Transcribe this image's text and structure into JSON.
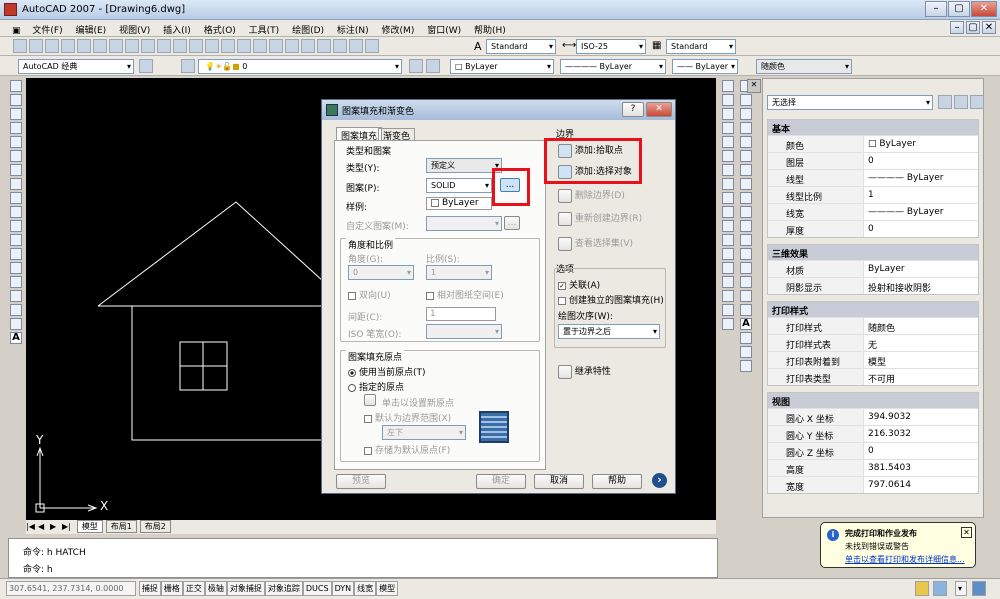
{
  "window": {
    "title": "AutoCAD 2007 - [Drawing6.dwg]"
  },
  "menu": [
    "文件(F)",
    "编辑(E)",
    "视图(V)",
    "插入(I)",
    "格式(O)",
    "工具(T)",
    "绘图(D)",
    "标注(N)",
    "修改(M)",
    "窗口(W)",
    "帮助(H)"
  ],
  "toolbar": {
    "text_style": "Standard",
    "dim_style": "ISO-25",
    "table_style": "Standard",
    "workspace": "AutoCAD 经典",
    "layer": "0",
    "color": "ByLayer",
    "linetype": "ByLayer",
    "lineweight": "ByLayer",
    "plotstyle": "随颜色"
  },
  "dialog": {
    "title": "图案填充和渐变色",
    "help_btn": "?",
    "tabs": [
      "图案填充",
      "渐变色"
    ],
    "type_group": "类型和图案",
    "type_label": "类型(Y):",
    "type_value": "预定义",
    "pattern_label": "图案(P):",
    "pattern_value": "SOLID",
    "browse": "...",
    "swatch_label": "样例:",
    "swatch_value": "ByLayer",
    "custom_label": "自定义图案(M):",
    "angle_group": "角度和比例",
    "angle_label": "角度(G):",
    "angle_value": "0",
    "scale_label": "比例(S):",
    "scale_value": "1",
    "double_label": "双向(U)",
    "relative_label": "相对图纸空间(E)",
    "spacing_label": "间距(C):",
    "spacing_value": "1",
    "iso_label": "ISO 笔宽(O):",
    "origin_group": "图案填充原点",
    "use_current": "使用当前原点(T)",
    "specified": "指定的原点",
    "click_set": "单击以设置新原点",
    "default_boundary": "默认为边界范围(X)",
    "pos_value": "左下",
    "store_default": "存储为默认原点(F)",
    "boundary_group": "边界",
    "add_pick": "添加:拾取点",
    "add_select": "添加:选择对象",
    "remove": "删除边界(D)",
    "recreate": "重新创建边界(R)",
    "view_sel": "查看选择集(V)",
    "options_group": "选项",
    "assoc": "关联(A)",
    "independent": "创建独立的图案填充(H)",
    "draw_order_label": "绘图次序(W):",
    "draw_order_value": "置于边界之后",
    "inherit": "继承特性",
    "preview": "预览",
    "ok": "确定",
    "cancel": "取消",
    "help": "帮助",
    "more": "›"
  },
  "props": {
    "select": "无选择",
    "sections": [
      {
        "title": "基本",
        "rows": [
          [
            "颜色",
            "□ ByLayer"
          ],
          [
            "图层",
            "0"
          ],
          [
            "线型",
            "———— ByLayer"
          ],
          [
            "线型比例",
            "1"
          ],
          [
            "线宽",
            "———— ByLayer"
          ],
          [
            "厚度",
            "0"
          ]
        ]
      },
      {
        "title": "三维效果",
        "rows": [
          [
            "材质",
            "ByLayer"
          ],
          [
            "阴影显示",
            "投射和接收阴影"
          ]
        ]
      },
      {
        "title": "打印样式",
        "rows": [
          [
            "打印样式",
            "随颜色"
          ],
          [
            "打印样式表",
            "无"
          ],
          [
            "打印表附着到",
            "模型"
          ],
          [
            "打印表类型",
            "不可用"
          ]
        ]
      },
      {
        "title": "视图",
        "rows": [
          [
            "圆心 X 坐标",
            "394.9032"
          ],
          [
            "圆心 Y 坐标",
            "216.3032"
          ],
          [
            "圆心 Z 坐标",
            "0"
          ],
          [
            "高度",
            "381.5403"
          ],
          [
            "宽度",
            "797.0614"
          ]
        ]
      }
    ]
  },
  "layout_tabs": [
    "模型",
    "布局1",
    "布局2"
  ],
  "command": {
    "line1": "命令: h HATCH",
    "line2": "命令: h"
  },
  "status": {
    "coords": "307.6541, 237.7314, 0.0000",
    "buttons": [
      "捕捉",
      "栅格",
      "正交",
      "极轴",
      "对象捕捉",
      "对象追踪",
      "DUCS",
      "DYN",
      "线宽",
      "模型"
    ]
  },
  "notification": {
    "title": "完成打印和作业发布",
    "body": "未找到错误或警告",
    "link": "单击以查看打印和发布详细信息..."
  },
  "axis": {
    "x": "X",
    "y": "Y"
  }
}
